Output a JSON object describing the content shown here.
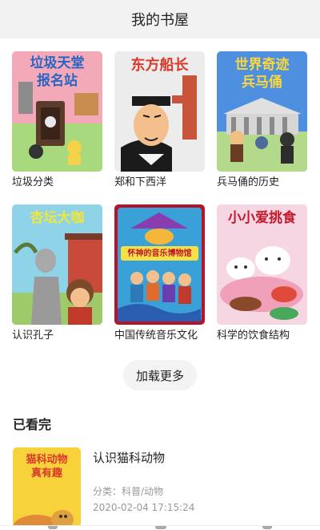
{
  "header": {
    "title": "我的书屋"
  },
  "books": [
    {
      "title": "垃圾分类",
      "cover_text": [
        "垃圾天堂",
        "报名站"
      ],
      "bg": "#f4b6c0"
    },
    {
      "title": "郑和下西洋",
      "cover_text": [
        "东方船长"
      ],
      "bg": "#e9e9e9"
    },
    {
      "title": "兵马俑的历史",
      "cover_text": [
        "世界奇迹",
        "兵马俑"
      ],
      "bg": "#4f8fe0"
    },
    {
      "title": "认识孔子",
      "cover_text": [
        "杏坛大咖"
      ],
      "bg": "#8fd3e8"
    },
    {
      "title": "中国传统音乐文化",
      "cover_text": [
        "怀神的音乐博物馆"
      ],
      "bg": "#c0172a"
    },
    {
      "title": "科学的饮食结构",
      "cover_text": [
        "小小爱挑食"
      ],
      "bg": "#f6d6e3"
    }
  ],
  "load_more": "加载更多",
  "watched_section": {
    "title": "已看完",
    "item": {
      "title": "认识猫科动物",
      "cover_text": [
        "猫科动物",
        "真有趣"
      ],
      "category": "分类：科普/动物",
      "time": "2020-02-04 17:15:24"
    }
  }
}
